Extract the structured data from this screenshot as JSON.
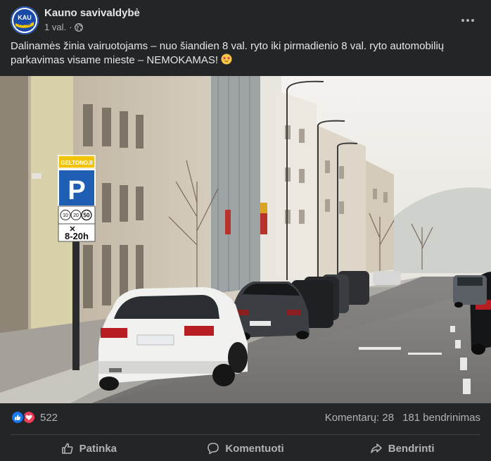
{
  "post": {
    "page_name": "Kauno savivaldybė",
    "timestamp": "1 val.",
    "separator": "·",
    "privacy_icon": "globe-icon",
    "more_icon": "more-options-icon",
    "avatar": {
      "logo_text": "KAU NAS",
      "colors": {
        "ring": "#1a4aa8",
        "accent": "#f2c300"
      }
    },
    "text": "Dalinamės žinia vairuotojams – nuo šiandien 8 val. ryto iki pirmadienio 8 val. ryto automobilių parkavimas visame mieste – NEMOKAMAS!",
    "emoji": "star-struck-emoji",
    "photo": {
      "description_icon": "street-photo",
      "sign_top": "GELTONOJI",
      "sign_letter": "P",
      "sign_times": [
        "10",
        "20",
        "50"
      ],
      "sign_hours": "8-20h"
    }
  },
  "stats": {
    "reaction_icons": [
      "like-icon",
      "love-icon"
    ],
    "reaction_count": "522",
    "comments": "Komentarų: 28",
    "shares": "181 bendrinimas"
  },
  "actions": {
    "like_label": "Patinka",
    "comment_label": "Komentuoti",
    "share_label": "Bendrinti"
  },
  "colors": {
    "background": "#242526",
    "text_primary": "#e4e6eb",
    "text_secondary": "#b0b3b8",
    "like_blue": "#1877f2",
    "love_red": "#f33e58"
  }
}
